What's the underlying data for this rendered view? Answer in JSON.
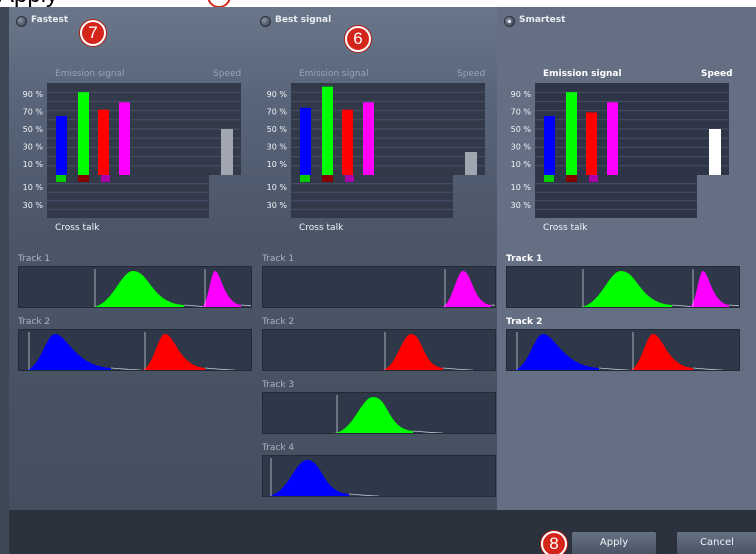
{
  "top_text": "Apply",
  "colors": {
    "green": "#00ff00",
    "blue": "#0000ff",
    "red": "#ff0000",
    "magenta": "#ff00ff",
    "speed_light": "#ffffff",
    "speed_dim": "#a2a6b0"
  },
  "chart_labels": {
    "emission": "Emission signal",
    "speed": "Speed",
    "crosstalk": "Cross talk",
    "y_ticks": [
      "90 %",
      "70 %",
      "50 %",
      "30 %",
      "10 %"
    ],
    "ct_ticks": [
      "10 %",
      "30 %"
    ]
  },
  "panels": [
    {
      "id": "fastest",
      "label": "Fastest",
      "selected": false,
      "badge": "7",
      "emission_values": [
        0.64,
        0.9,
        0.71,
        0.79
      ],
      "speed_value": 0.5,
      "crosstalk_colors": [
        "#00cc00",
        "#880000",
        "#aa00aa"
      ],
      "tracks": [
        {
          "label": "Track 1",
          "peaks": [
            "green",
            "magenta"
          ]
        },
        {
          "label": "Track 2",
          "peaks": [
            "blue",
            "red"
          ]
        }
      ]
    },
    {
      "id": "best",
      "label": "Best signal",
      "selected": false,
      "badge": "6",
      "emission_values": [
        0.73,
        0.96,
        0.71,
        0.79
      ],
      "speed_value": 0.25,
      "crosstalk_colors": [
        "#00cc00",
        "#880000",
        "#aa00aa"
      ],
      "tracks": [
        {
          "label": "Track 1",
          "peaks": [
            "magenta"
          ]
        },
        {
          "label": "Track 2",
          "peaks": [
            "red"
          ]
        },
        {
          "label": "Track 3",
          "peaks": [
            "green"
          ]
        },
        {
          "label": "Track 4",
          "peaks": [
            "blue"
          ]
        }
      ]
    },
    {
      "id": "smartest",
      "label": "Smartest",
      "selected": true,
      "badge": "",
      "emission_values": [
        0.64,
        0.9,
        0.68,
        0.79
      ],
      "speed_value": 0.5,
      "crosstalk_colors": [
        "#00cc00",
        "#880000",
        "#aa00aa"
      ],
      "tracks": [
        {
          "label": "Track 1",
          "peaks": [
            "green",
            "magenta"
          ]
        },
        {
          "label": "Track 2",
          "peaks": [
            "blue",
            "red"
          ]
        }
      ]
    }
  ],
  "buttons": {
    "apply": "Apply",
    "cancel": "Cancel",
    "apply_badge": "8"
  }
}
